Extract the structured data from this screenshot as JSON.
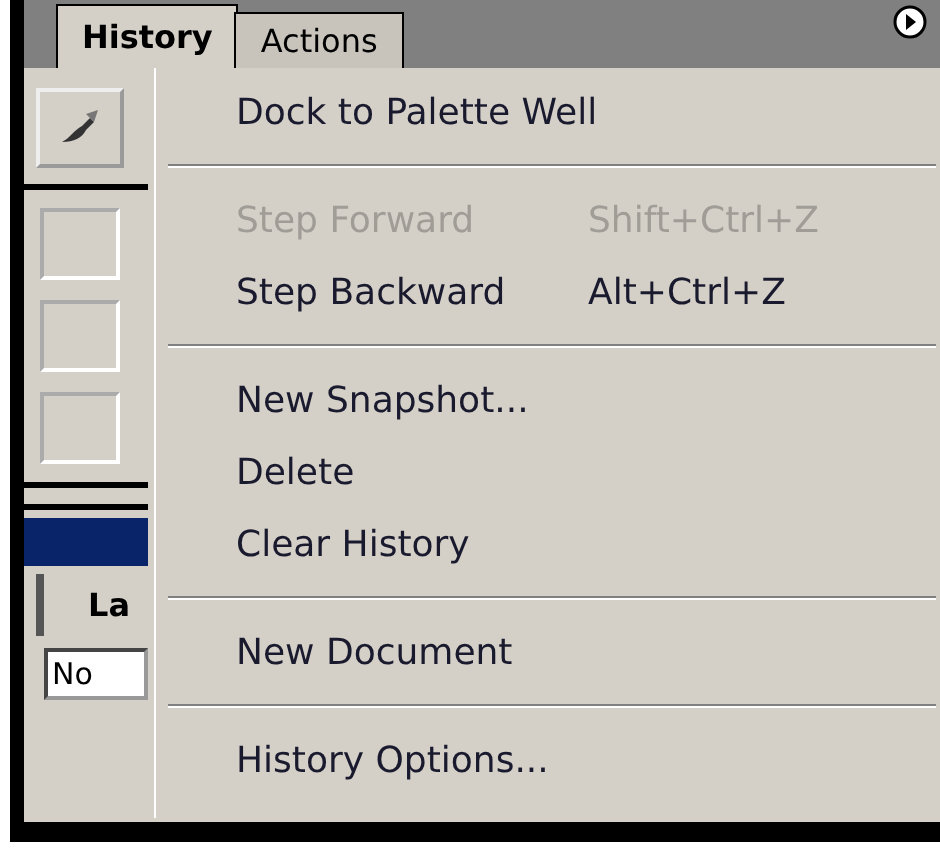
{
  "tabs": [
    {
      "label": "History",
      "selected": true
    },
    {
      "label": "Actions",
      "selected": false
    }
  ],
  "side_panel": {
    "layers_tab": "La",
    "blend_field": "No"
  },
  "menu": {
    "items": [
      {
        "kind": "item",
        "label": "Dock to Palette Well",
        "disabled": false
      },
      {
        "kind": "separator"
      },
      {
        "kind": "item",
        "label": "Step Forward",
        "shortcut": "Shift+Ctrl+Z",
        "disabled": true
      },
      {
        "kind": "item",
        "label": "Step Backward",
        "shortcut": "Alt+Ctrl+Z",
        "disabled": false
      },
      {
        "kind": "separator"
      },
      {
        "kind": "item",
        "label": "New Snapshot...",
        "disabled": false
      },
      {
        "kind": "item",
        "label": "Delete",
        "disabled": false
      },
      {
        "kind": "item",
        "label": "Clear History",
        "disabled": false
      },
      {
        "kind": "separator"
      },
      {
        "kind": "item",
        "label": "New Document",
        "disabled": false
      },
      {
        "kind": "separator"
      },
      {
        "kind": "item",
        "label": "History Options...",
        "disabled": false
      }
    ]
  }
}
